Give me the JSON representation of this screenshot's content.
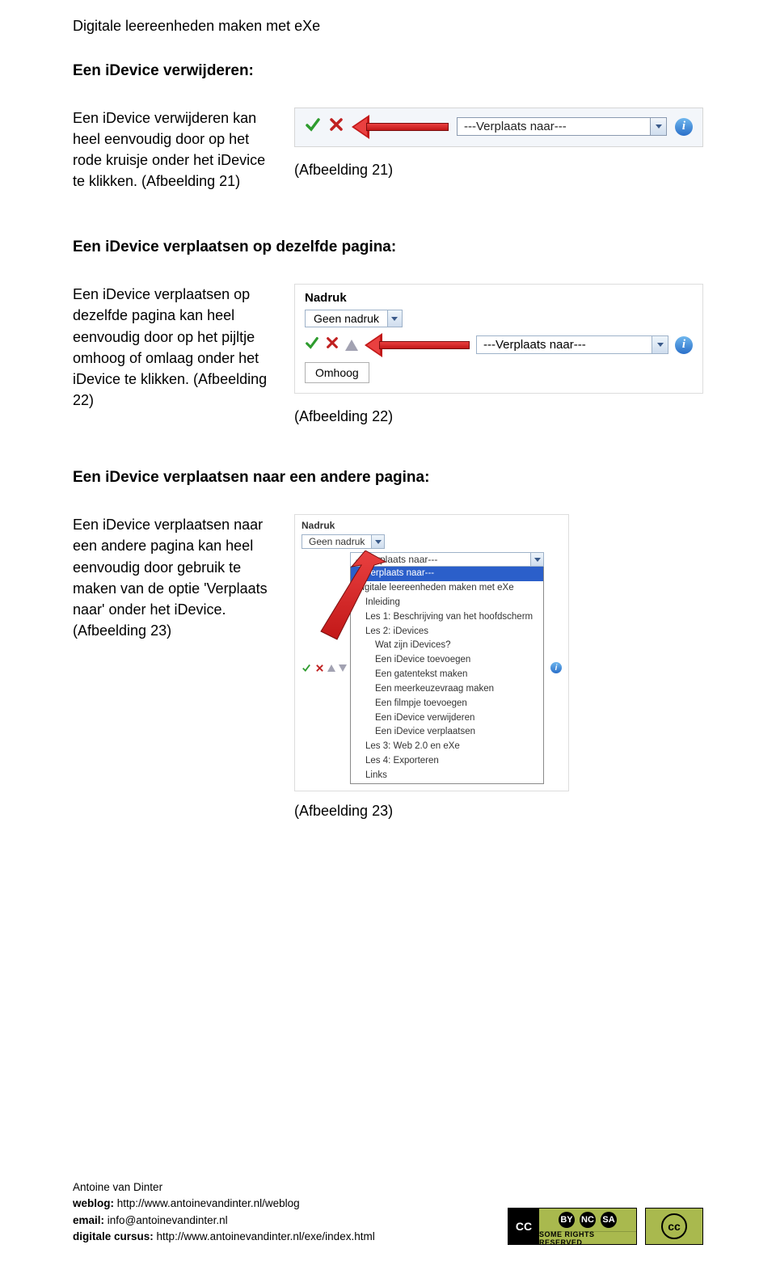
{
  "page_title": "Digitale leereenheden maken met eXe",
  "section1": {
    "heading": "Een iDevice verwijderen:",
    "body": "Een iDevice verwijderen kan heel eenvoudig door op het rode kruisje onder het iDevice te klikken. (Afbeelding 21)",
    "fig_caption": "(Afbeelding 21)",
    "fig21": {
      "dropdown_text": "---Verplaats naar---"
    }
  },
  "section2": {
    "heading": "Een iDevice verplaatsen op dezelfde pagina:",
    "body": "Een iDevice verplaatsen op dezelfde pagina  kan heel eenvoudig door op het pijltje omhoog of omlaag onder het iDevice te klikken. (Afbeelding 22)",
    "fig_caption": "(Afbeelding 22)",
    "fig22": {
      "label": "Nadruk",
      "geen_nadruk": "Geen nadruk",
      "dropdown_text": "---Verplaats naar---",
      "omhoog": "Omhoog"
    }
  },
  "section3": {
    "heading": "Een iDevice verplaatsen naar een andere pagina:",
    "body": "Een iDevice verplaatsen naar een andere pagina  kan heel eenvoudig door gebruik te maken van de optie 'Verplaats naar' onder het iDevice. (Afbeelding 23)",
    "fig_caption": "(Afbeelding 23)",
    "fig23": {
      "label": "Nadruk",
      "geen_nadruk": "Geen nadruk",
      "sel_text": "---Verplaats naar---",
      "items": [
        "---Verplaats naar---",
        "Digitale leereenheden maken met eXe",
        "Inleiding",
        "Les 1: Beschrijving van het hoofdscherm",
        "Les 2: iDevices",
        "Wat zijn iDevices?",
        "Een iDevice toevoegen",
        "Een gatentekst maken",
        "Een meerkeuzevraag maken",
        "Een filmpje toevoegen",
        "Een iDevice verwijderen",
        "Een iDevice verplaatsen",
        "Les 3: Web 2.0 en eXe",
        "Les 4: Exporteren",
        "Links"
      ]
    }
  },
  "footer": {
    "author": "Antoine van Dinter",
    "weblog_label": "weblog:",
    "weblog_url": "http://www.antoinevandinter.nl/weblog",
    "email_label": "email:",
    "email": "info@antoinevandinter.nl",
    "cursus_label": "digitale cursus:",
    "cursus_url": "http://www.antoinevandinter.nl/exe/index.html",
    "cc_icons": {
      "by": "BY",
      "nc": "NC",
      "sa": "SA"
    },
    "cc_text": "SOME RIGHTS RESERVED",
    "cc_small": "cc"
  }
}
